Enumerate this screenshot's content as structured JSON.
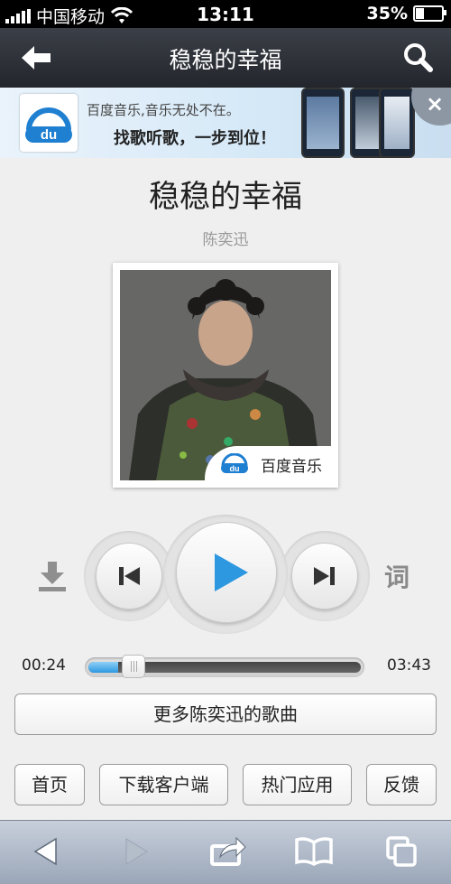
{
  "status_bar": {
    "carrier": "中国移动",
    "time": "13:11",
    "battery_percent": "35%",
    "battery_level": 0.35
  },
  "navbar": {
    "title": "稳稳的幸福",
    "back_icon": "back-arrow-icon",
    "search_icon": "search-icon"
  },
  "banner": {
    "logo_text": "du",
    "line1": "百度音乐,音乐无处不在。",
    "line2": "找歌听歌，一步到位！",
    "close_label": "×"
  },
  "song": {
    "title": "稳稳的幸福",
    "artist": "陈奕迅"
  },
  "cover": {
    "badge_logo_text": "du",
    "badge_text": "百度音乐"
  },
  "controls": {
    "download_icon": "download-icon",
    "prev_icon": "previous-track-icon",
    "play_icon": "play-icon",
    "next_icon": "next-track-icon",
    "lyrics_label": "词"
  },
  "progress": {
    "current_time": "00:24",
    "total_time": "03:43",
    "fraction": 0.11
  },
  "more_songs_label": "更多陈奕迅的歌曲",
  "footer_links": [
    {
      "label": "首页"
    },
    {
      "label": "下载客户端"
    },
    {
      "label": "热门应用"
    },
    {
      "label": "反馈"
    }
  ],
  "browser_toolbar": {
    "icons": [
      "back-icon",
      "forward-icon",
      "share-icon",
      "bookmarks-icon",
      "tabs-icon"
    ]
  },
  "colors": {
    "accent_blue": "#2d98e0",
    "navbar_dark": "#2b2e35",
    "page_bg": "#efefef"
  }
}
